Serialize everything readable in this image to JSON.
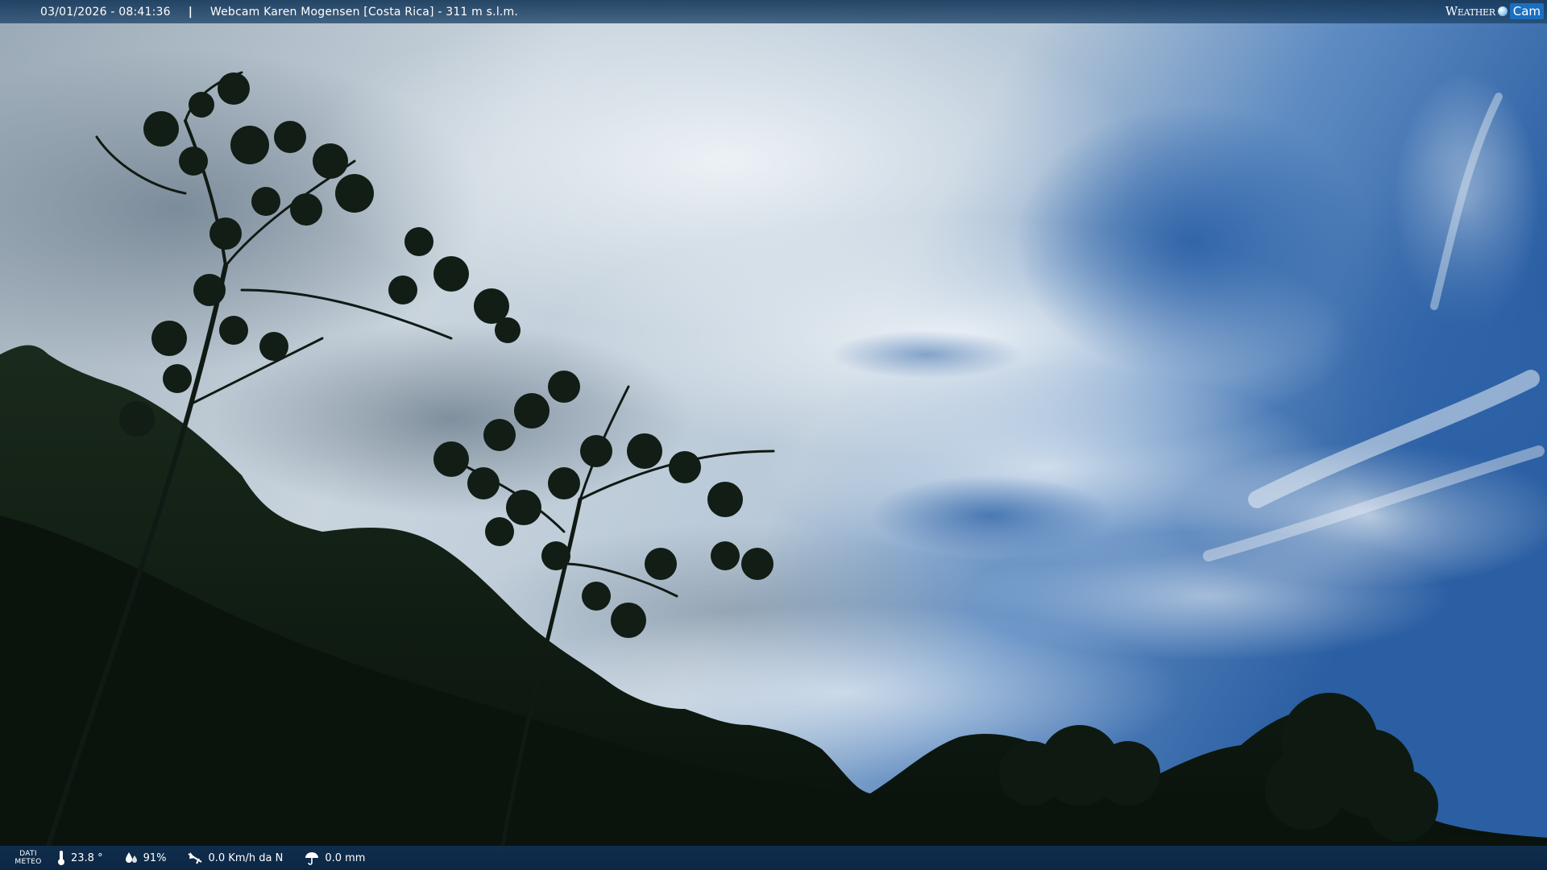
{
  "header": {
    "datetime": "03/01/2026 - 08:41:36",
    "separator": "|",
    "title": "Webcam Karen Mogensen [Costa Rica]  - 311 m s.l.m.",
    "brand_word1": "Weather",
    "brand_word2": "Cam"
  },
  "footer": {
    "dati_line1": "DATI",
    "dati_line2": "METEO",
    "temperature": "23.8 °",
    "humidity": "91%",
    "wind": "0.0 Km/h da N",
    "rain": "0.0 mm"
  },
  "colors": {
    "sky_blue": "#2f64a6",
    "cloud_white": "#e3ebf2",
    "foliage": "#0d1a12",
    "bar": "#143a62"
  },
  "icons": [
    "thermometer-icon",
    "humidity-drops-icon",
    "wind-icon",
    "rain-umbrella-icon"
  ]
}
